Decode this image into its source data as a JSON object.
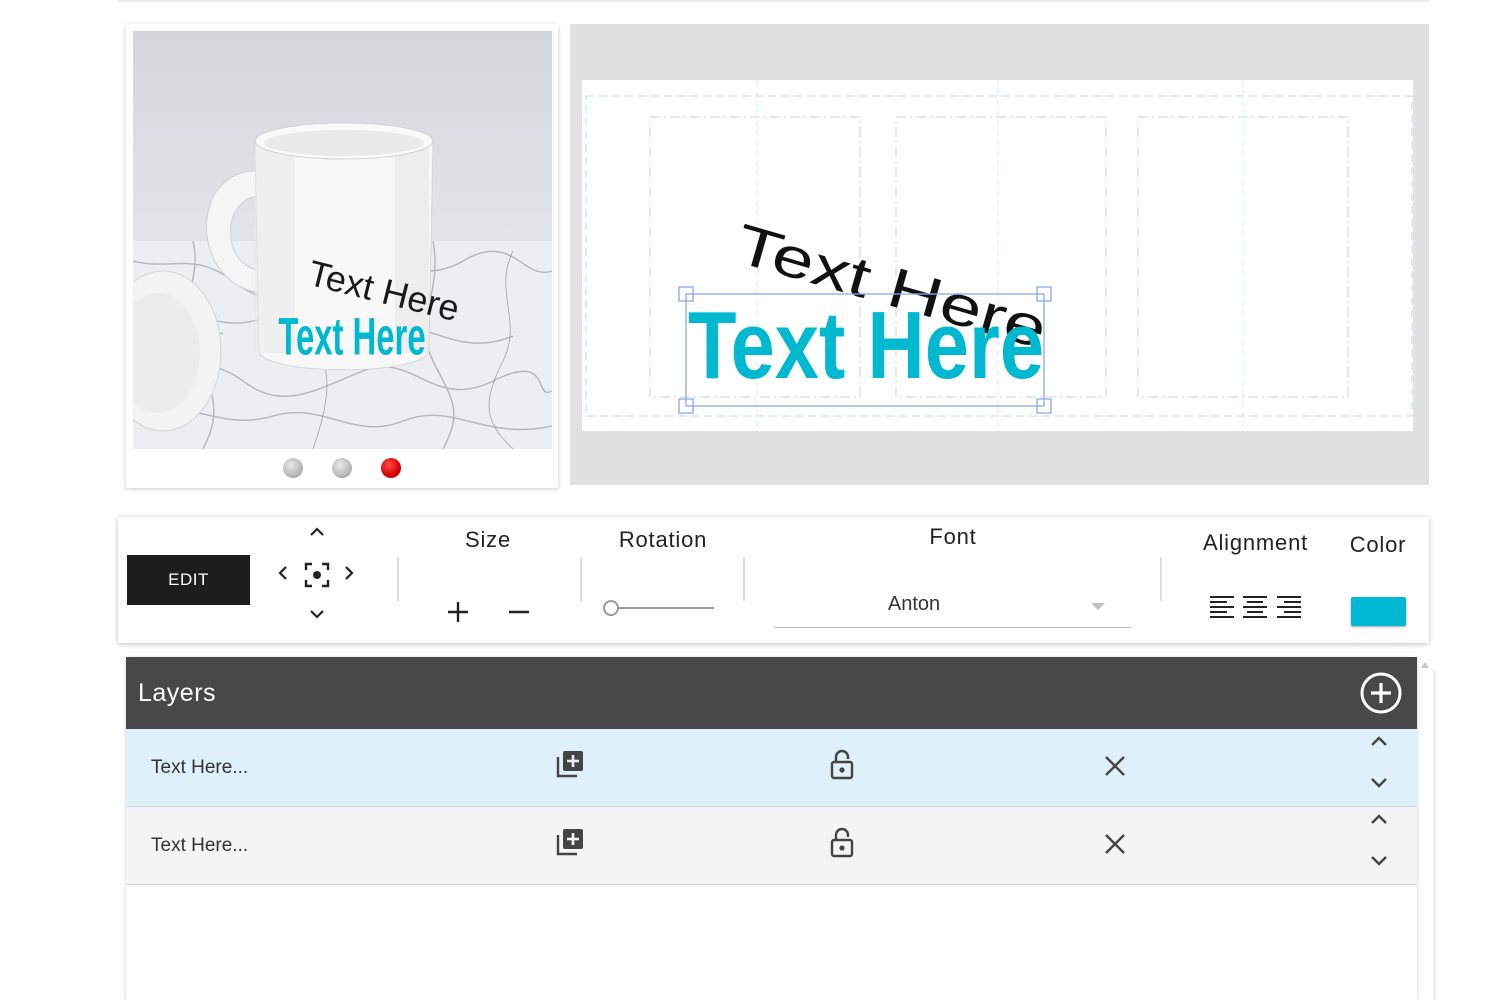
{
  "preview": {
    "print_text": "Text Here",
    "curved_text": "Text Here",
    "view_dots": [
      {
        "name": "view-dot-1",
        "state": "inactive"
      },
      {
        "name": "view-dot-2",
        "state": "inactive"
      },
      {
        "name": "view-dot-3",
        "state": "active"
      }
    ]
  },
  "canvas": {
    "main_text": "Text Here",
    "curved_text": "Text Here",
    "text_color": "#00b8d0"
  },
  "toolbar": {
    "edit_label": "EDIT",
    "size_label": "Size",
    "rotation_label": "Rotation",
    "rotation_value": 0,
    "font_label": "Font",
    "font_value": "Anton",
    "alignment_label": "Alignment",
    "color_label": "Color",
    "color_value": "#00b8d4",
    "icons": [
      "move-up-icon",
      "move-left-icon",
      "center-icon",
      "move-right-icon",
      "move-down-icon",
      "plus-icon",
      "minus-icon",
      "align-left-icon",
      "align-center-icon",
      "align-right-icon",
      "chevron-down-icon"
    ]
  },
  "layers": {
    "title": "Layers",
    "add_icon": "add-circle-icon",
    "items": [
      {
        "name": "Text Here...",
        "selected": true
      },
      {
        "name": "Text Here...",
        "selected": false
      }
    ],
    "row_icons": [
      "duplicate-icon",
      "lock-icon",
      "close-icon",
      "chevron-up-icon",
      "chevron-down-icon"
    ]
  },
  "colors": {
    "accent": "#00b8d4",
    "header_bg": "#484848",
    "selected_row": "#def1fa",
    "active_dot": "#e00000",
    "edit_button": "#1d1d1d"
  }
}
